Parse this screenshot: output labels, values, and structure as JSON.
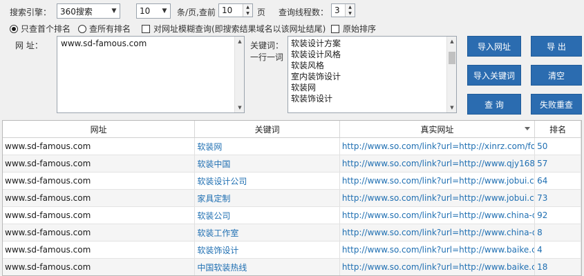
{
  "toolbar": {
    "engine_label": "搜索引擎：",
    "engine_value": "360搜索",
    "per_page_value": "10",
    "per_page_suffix": "条/页,查前",
    "pages_value": "10",
    "pages_unit": "页",
    "threads_label": "查询线程数：",
    "threads_value": "3"
  },
  "options": {
    "radio_first": "只查首个排名",
    "radio_all": "查所有排名",
    "fuzzy_check": "对网址模糊查询(即搜索结果域名以该网址结尾)",
    "raw_sort_check": "原始排序"
  },
  "url_panel": {
    "label": "网   址：",
    "value": "www.sd-famous.com"
  },
  "keyword_panel": {
    "label_line1": "关键词：",
    "label_line2": "一行一词",
    "keywords": [
      "软装设计方案",
      "软装设计风格",
      "软装风格",
      "室内装饰设计",
      "软装网",
      "软装饰设计"
    ]
  },
  "buttons": {
    "import_url": "导入网址",
    "export": "导  出",
    "import_keywords": "导入关键词",
    "clear": "清空",
    "query": "查  询",
    "retry_failed": "失败重查"
  },
  "colors": {
    "button_bg": "#2b6cb0",
    "link_text": "#1f6fb2"
  },
  "table": {
    "headers": [
      "网址",
      "关键词",
      "真实网址",
      "排名"
    ],
    "rows": [
      {
        "url": "www.sd-famous.com",
        "keyword": "软装网",
        "real_url": "http://www.so.com/link?url=http://xinrz.com/fo...",
        "rank": "50"
      },
      {
        "url": "www.sd-famous.com",
        "keyword": "软装中国",
        "real_url": "http://www.so.com/link?url=http://www.qjy168....",
        "rank": "57"
      },
      {
        "url": "www.sd-famous.com",
        "keyword": "软装设计公司",
        "real_url": "http://www.so.com/link?url=http://www.jobui.c...",
        "rank": "64"
      },
      {
        "url": "www.sd-famous.com",
        "keyword": "家具定制",
        "real_url": "http://www.so.com/link?url=http://www.jobui.c...",
        "rank": "73"
      },
      {
        "url": "www.sd-famous.com",
        "keyword": "软装公司",
        "real_url": "http://www.so.com/link?url=http://www.china-d...",
        "rank": "92"
      },
      {
        "url": "www.sd-famous.com",
        "keyword": "软装工作室",
        "real_url": "http://www.so.com/link?url=http://www.china-d...",
        "rank": "8"
      },
      {
        "url": "www.sd-famous.com",
        "keyword": "软装饰设计",
        "real_url": "http://www.so.com/link?url=http://www.baike.c...",
        "rank": "4"
      },
      {
        "url": "www.sd-famous.com",
        "keyword": "中国软装热线",
        "real_url": "http://www.so.com/link?url=http://www.baike.c...",
        "rank": "18"
      }
    ]
  }
}
